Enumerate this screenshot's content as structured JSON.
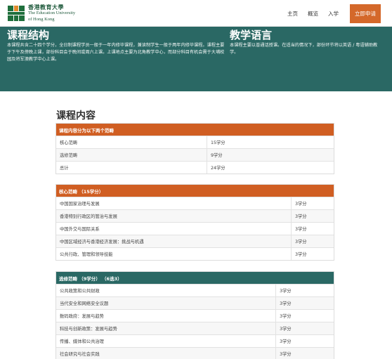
{
  "header": {
    "logo_zh": "香港教育大學",
    "logo_en_line1": "The Education University",
    "logo_en_line2": "of Hong Kong",
    "nav": [
      "主页",
      "概览",
      "入学"
    ],
    "apply_label": "立即申请"
  },
  "hero": {
    "structure": {
      "title": "课程结构",
      "body": "本课程共含二十四个学分，全日制课程学员一般于一年内修毕课程，兼读制学生一般于两年内修毕课程。课程主要于下午及傍晚上课，部份科目会于晚间或周六上课。上课地点主要为北角教学中心，而部分科目有机会需于大埔校园及将军澳教学中心上课。"
    },
    "language": {
      "title": "教学语言",
      "body": "本课程主要以普通话授课。在适当的情况下，部份环节将以英语 / 粤语辅助教学。"
    }
  },
  "content_title": "课程内容",
  "summary_table": {
    "header": "课程内容分为以下两个范畴",
    "rows": [
      {
        "name": "核心范畴",
        "credits": "15学分"
      },
      {
        "name": "选修范畴",
        "credits": "9学分"
      },
      {
        "name": "总计",
        "credits": "24学分"
      }
    ]
  },
  "core_table": {
    "header": "核心范畴 （15学分）",
    "rows": [
      {
        "name": "中国国家治理与发展",
        "credits": "3学分"
      },
      {
        "name": "香港特别行政区的管治与发展",
        "credits": "3学分"
      },
      {
        "name": "中国外交与国际关系",
        "credits": "3学分"
      },
      {
        "name": "中国区域经济与香港经济发展：挑战与机遇",
        "credits": "3学分"
      },
      {
        "name": "公共行政、管理和领导技能",
        "credits": "3学分"
      }
    ]
  },
  "elective_table": {
    "header": "选修范畴 （9学分） （6选3）",
    "rows": [
      {
        "name": "公共政策和公共财政",
        "credits": "3学分"
      },
      {
        "name": "当代安全和网络安全议题",
        "credits": "3学分"
      },
      {
        "name": "数码政府：发展与趋势",
        "credits": "3学分"
      },
      {
        "name": "科技与创新政策：发展与趋势",
        "credits": "3学分"
      },
      {
        "name": "传播、媒体和公共治理",
        "credits": "3学分"
      },
      {
        "name": "社会研究与社会实践",
        "credits": "3学分"
      }
    ]
  },
  "colors": {
    "teal": "#2a6864",
    "orange": "#d05e22",
    "logo_green": "#1f5a3c"
  }
}
